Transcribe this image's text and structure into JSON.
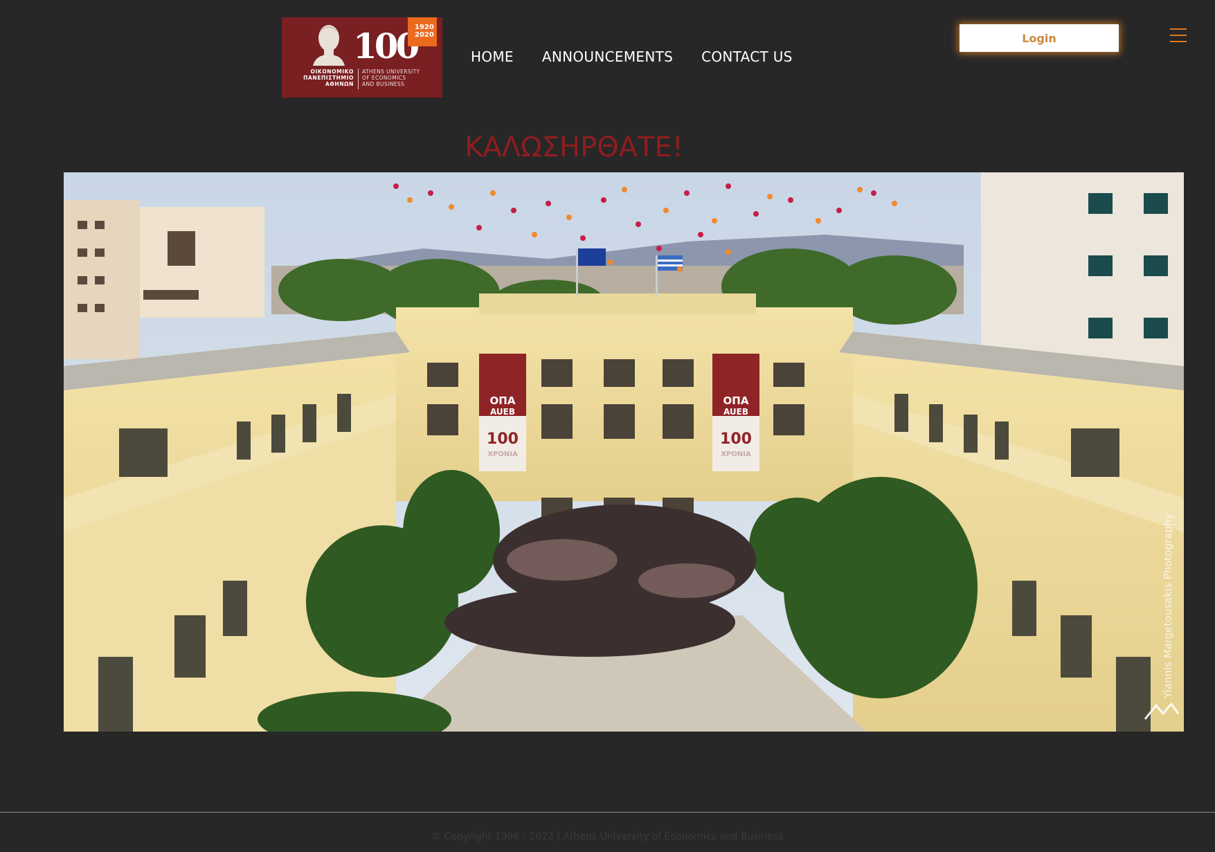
{
  "header": {
    "logo": {
      "years": "1920 2020",
      "hundred": "100",
      "greek_lines": [
        "ΟΙΚΟΝΟΜΙΚΟ",
        "ΠΑΝΕΠΙΣΤΗΜΙΟ",
        "ΑΘΗΝΩΝ"
      ],
      "english_lines": [
        "ATHENS UNIVERSITY",
        "OF ECONOMICS",
        "AND BUSINESS"
      ]
    },
    "nav": [
      {
        "label": "HOME"
      },
      {
        "label": "ANNOUNCEMENTS"
      },
      {
        "label": "CONTACT US"
      }
    ],
    "login_label": "Login",
    "menu_icon": "hamburger-icon"
  },
  "main": {
    "welcome": "ΚΑΛΩΣΗΡΘΑΤΕ!",
    "hero": {
      "banner_text_1": "ΟΠΑ",
      "banner_text_2": "AUEB",
      "banner_text_3": "100",
      "banner_text_4": "ΧΡΟΝΙΑ",
      "photo_credit": "Yiannis Margetousakis Photography"
    }
  },
  "footer": {
    "copyright": "© Copyright 1996 - 2022 | Athens University of Economics and Business"
  },
  "colors": {
    "background": "#272727",
    "accent": "#e07a1f",
    "brand_red": "#8e1d1f",
    "logo_bg": "#7a1f22"
  }
}
